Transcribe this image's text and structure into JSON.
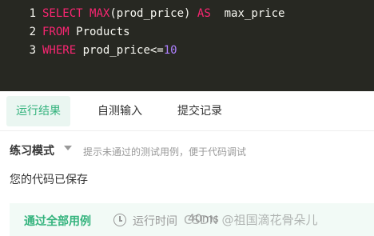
{
  "editor": {
    "lines": [
      {
        "number": "1",
        "tokens": [
          "SELECT",
          " ",
          "MAX",
          "(prod_price) ",
          "AS",
          "  max_price"
        ]
      },
      {
        "number": "2",
        "tokens": [
          "FROM",
          " Products"
        ]
      },
      {
        "number": "3",
        "tokens": [
          "WHERE",
          " prod_price<=",
          "10"
        ]
      }
    ]
  },
  "tabs": [
    {
      "label": "运行结果",
      "active": true
    },
    {
      "label": "自测输入",
      "active": false
    },
    {
      "label": "提交记录",
      "active": false
    }
  ],
  "mode": {
    "title": "练习模式",
    "hint": "提示未通过的测试用例，便于代码调试"
  },
  "save_status": "您的代码已保存",
  "result": {
    "status": "通过全部用例",
    "runtime_label": "运行时间",
    "runtime_value": "40ms"
  },
  "watermark": "CSDN @祖国滴花骨朵儿",
  "colors": {
    "editor_bg": "#272822",
    "keyword": "#f92672",
    "number": "#ae81ff",
    "accent": "#34b37d",
    "result_bg": "#f2faf6"
  }
}
